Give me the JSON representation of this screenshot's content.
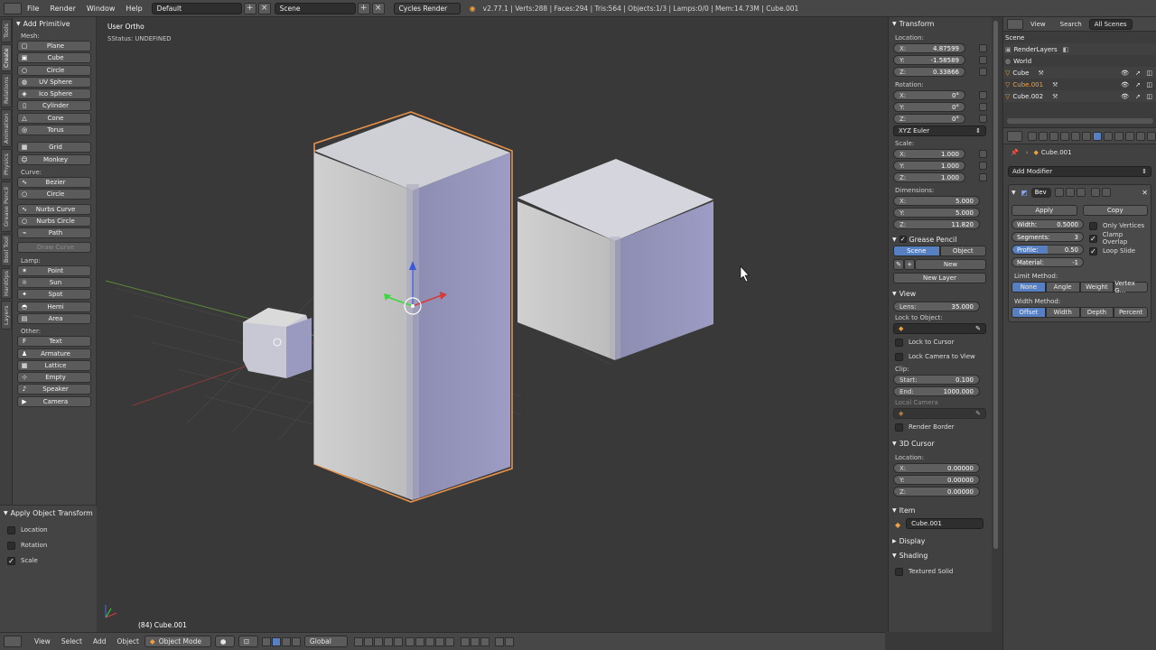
{
  "topbar": {
    "menus": [
      "File",
      "Render",
      "Window",
      "Help"
    ],
    "screen_layout": "Default",
    "scene": "Scene",
    "engine": "Cycles Render",
    "stats": "v2.77.1 | Verts:288 | Faces:294 | Tris:564 | Objects:1/3 | Lamps:0/0 | Mem:14.73M | Cube.001"
  },
  "tabs": [
    "Tools",
    "Create",
    "Relations",
    "Animation",
    "Physics",
    "Grease Pencil",
    "Bool Tool",
    "HardOps",
    "Layers"
  ],
  "toolshelf": {
    "title": "Add Primitive",
    "sections": [
      {
        "label": "Mesh:",
        "items": [
          "Plane",
          "Cube",
          "Circle",
          "UV Sphere",
          "Ico Sphere",
          "Cylinder",
          "Cone",
          "Torus"
        ]
      },
      {
        "label": "",
        "items": [
          "Grid",
          "Monkey"
        ]
      },
      {
        "label": "Curve:",
        "items": [
          "Bezier",
          "Circle"
        ]
      },
      {
        "label": "",
        "items": [
          "Nurbs Curve",
          "Nurbs Circle",
          "Path"
        ]
      },
      {
        "label": "",
        "items": [
          "Draw Curve"
        ]
      },
      {
        "label": "Lamp:",
        "items": [
          "Point",
          "Sun",
          "Spot",
          "Hemi",
          "Area"
        ]
      },
      {
        "label": "Other:",
        "items": [
          "Text",
          "Armature",
          "Lattice",
          "Empty",
          "Speaker",
          "Camera"
        ]
      }
    ]
  },
  "operator": {
    "title": "Apply Object Transform",
    "options": [
      {
        "label": "Location",
        "checked": false
      },
      {
        "label": "Rotation",
        "checked": false
      },
      {
        "label": "Scale",
        "checked": true
      }
    ]
  },
  "viewport": {
    "view_name": "User Ortho",
    "status": "SStatus: UNDEFINED",
    "object_info": "(84) Cube.001"
  },
  "bottombar": {
    "menus": [
      "View",
      "Select",
      "Add",
      "Object"
    ],
    "mode": "Object Mode",
    "orientation": "Global"
  },
  "npanel": {
    "transform": {
      "title": "Transform",
      "location_label": "Location:",
      "location": [
        {
          "k": "X:",
          "v": "4.87599"
        },
        {
          "k": "Y:",
          "v": "-1.58589"
        },
        {
          "k": "Z:",
          "v": "0.33866"
        }
      ],
      "rotation_label": "Rotation:",
      "rotation": [
        {
          "k": "X:",
          "v": "0°"
        },
        {
          "k": "Y:",
          "v": "0°"
        },
        {
          "k": "Z:",
          "v": "0°"
        }
      ],
      "rotation_mode": "XYZ Euler",
      "scale_label": "Scale:",
      "scale": [
        {
          "k": "X:",
          "v": "1.000"
        },
        {
          "k": "Y:",
          "v": "1.000"
        },
        {
          "k": "Z:",
          "v": "1.000"
        }
      ],
      "dimensions_label": "Dimensions:",
      "dimensions": [
        {
          "k": "X:",
          "v": "5.000"
        },
        {
          "k": "Y:",
          "v": "5.000"
        },
        {
          "k": "Z:",
          "v": "11.820"
        }
      ]
    },
    "grease": {
      "title": "Grease Pencil",
      "seg": [
        "Scene",
        "Object"
      ],
      "new": "New",
      "new_layer": "New Layer"
    },
    "view": {
      "title": "View",
      "lens_k": "Lens:",
      "lens_v": "35.000",
      "lock_object": "Lock to Object:",
      "lock_cursor": "Lock to Cursor",
      "lock_camera": "Lock Camera to View",
      "clip": "Clip:",
      "start_k": "Start:",
      "start_v": "0.100",
      "end_k": "End:",
      "end_v": "1000.000",
      "local_camera": "Local Camera",
      "render_border": "Render Border"
    },
    "cursor": {
      "title": "3D Cursor",
      "location_label": "Location:",
      "location": [
        {
          "k": "X:",
          "v": "0.00000"
        },
        {
          "k": "Y:",
          "v": "0.00000"
        },
        {
          "k": "Z:",
          "v": "0.00000"
        }
      ]
    },
    "item": {
      "title": "Item",
      "name": "Cube.001"
    },
    "display": {
      "title": "Display"
    },
    "shading": {
      "title": "Shading",
      "textured_solid": "Textured Solid"
    }
  },
  "outliner": {
    "tabs": [
      "View",
      "Search",
      "All Scenes"
    ],
    "rows": [
      "Scene",
      "RenderLayers",
      "World",
      "Cube",
      "Cube.001",
      "Cube.002"
    ]
  },
  "props": {
    "object_name": "Cube.001",
    "add_modifier": "Add Modifier",
    "mod_name": "Bev",
    "apply": "Apply",
    "copy": "Copy",
    "width_k": "Width:",
    "width_v": "0.5000",
    "segments_k": "Segments:",
    "segments_v": "3",
    "profile_k": "Profile:",
    "profile_v": "0.50",
    "material_k": "Material:",
    "material_v": "-1",
    "only_vertices": "Only Vertices",
    "clamp_overlap": "Clamp Overlap",
    "loop_slide": "Loop Slide",
    "limit_method": "Limit Method:",
    "limit_opts": [
      "None",
      "Angle",
      "Weight",
      "Vertex G..."
    ],
    "width_method": "Width Method:",
    "width_opts": [
      "Offset",
      "Width",
      "Depth",
      "Percent"
    ]
  }
}
